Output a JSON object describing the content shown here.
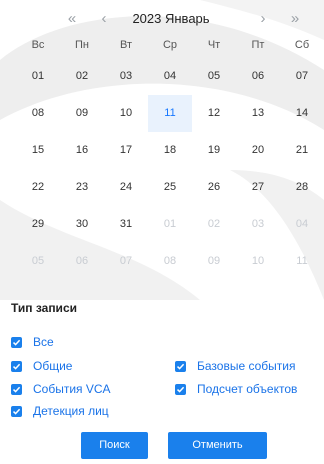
{
  "calendar": {
    "prev_year_icon": "double-chevron-left-icon",
    "prev_month_icon": "chevron-left-icon",
    "next_month_icon": "chevron-right-icon",
    "next_year_icon": "double-chevron-right-icon",
    "prev_year": "«",
    "prev_month": "‹",
    "next_month": "›",
    "next_year": "»",
    "title": "2023 Январь",
    "weekdays": [
      "Вс",
      "Пн",
      "Вт",
      "Ср",
      "Чт",
      "Пт",
      "Сб"
    ],
    "weeks": [
      [
        {
          "d": "01",
          "m": false,
          "s": false
        },
        {
          "d": "02",
          "m": false,
          "s": false
        },
        {
          "d": "03",
          "m": false,
          "s": false
        },
        {
          "d": "04",
          "m": false,
          "s": false
        },
        {
          "d": "05",
          "m": false,
          "s": false
        },
        {
          "d": "06",
          "m": false,
          "s": false
        },
        {
          "d": "07",
          "m": false,
          "s": false
        }
      ],
      [
        {
          "d": "08",
          "m": false,
          "s": false
        },
        {
          "d": "09",
          "m": false,
          "s": false
        },
        {
          "d": "10",
          "m": false,
          "s": false
        },
        {
          "d": "11",
          "m": false,
          "s": true
        },
        {
          "d": "12",
          "m": false,
          "s": false
        },
        {
          "d": "13",
          "m": false,
          "s": false
        },
        {
          "d": "14",
          "m": false,
          "s": false
        }
      ],
      [
        {
          "d": "15",
          "m": false,
          "s": false
        },
        {
          "d": "16",
          "m": false,
          "s": false
        },
        {
          "d": "17",
          "m": false,
          "s": false
        },
        {
          "d": "18",
          "m": false,
          "s": false
        },
        {
          "d": "19",
          "m": false,
          "s": false
        },
        {
          "d": "20",
          "m": false,
          "s": false
        },
        {
          "d": "21",
          "m": false,
          "s": false
        }
      ],
      [
        {
          "d": "22",
          "m": false,
          "s": false
        },
        {
          "d": "23",
          "m": false,
          "s": false
        },
        {
          "d": "24",
          "m": false,
          "s": false
        },
        {
          "d": "25",
          "m": false,
          "s": false
        },
        {
          "d": "26",
          "m": false,
          "s": false
        },
        {
          "d": "27",
          "m": false,
          "s": false
        },
        {
          "d": "28",
          "m": false,
          "s": false
        }
      ],
      [
        {
          "d": "29",
          "m": false,
          "s": false
        },
        {
          "d": "30",
          "m": false,
          "s": false
        },
        {
          "d": "31",
          "m": false,
          "s": false
        },
        {
          "d": "01",
          "m": true,
          "s": false
        },
        {
          "d": "02",
          "m": true,
          "s": false
        },
        {
          "d": "03",
          "m": true,
          "s": false
        },
        {
          "d": "04",
          "m": true,
          "s": false
        }
      ],
      [
        {
          "d": "05",
          "m": true,
          "s": false
        },
        {
          "d": "06",
          "m": true,
          "s": false
        },
        {
          "d": "07",
          "m": true,
          "s": false
        },
        {
          "d": "08",
          "m": true,
          "s": false
        },
        {
          "d": "09",
          "m": true,
          "s": false
        },
        {
          "d": "10",
          "m": true,
          "s": false
        },
        {
          "d": "11",
          "m": true,
          "s": false
        }
      ]
    ]
  },
  "record_type": {
    "title": "Тип записи",
    "options": {
      "all": {
        "label": "Все",
        "checked": true
      },
      "general": {
        "label": "Общие",
        "checked": true
      },
      "basic_events": {
        "label": "Базовые события",
        "checked": true
      },
      "vca_events": {
        "label": "События VCA",
        "checked": true
      },
      "object_count": {
        "label": "Подсчет объектов",
        "checked": true
      },
      "face_detection": {
        "label": "Детекция лиц",
        "checked": true
      }
    }
  },
  "buttons": {
    "search": "Поиск",
    "cancel": "Отменить"
  },
  "colors": {
    "accent": "#1a80ec",
    "selected_bg": "#e9f2fd",
    "muted_text": "#c8ccd2"
  }
}
